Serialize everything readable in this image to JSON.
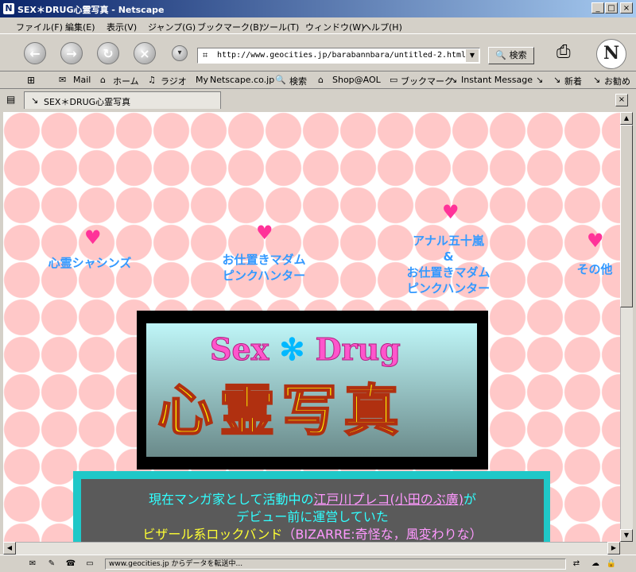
{
  "window": {
    "title": "SEX＊DRUG心霊写真 - Netscape",
    "app_icon": "netscape-icon",
    "minimize": "_",
    "maximize": "□",
    "close": "×"
  },
  "menu": [
    "ファイル(F)",
    "編集(E)",
    "表示(V)",
    "ジャンプ(G)",
    "ブックマーク(B)",
    "ツール(T)",
    "ウィンドウ(W)",
    "ヘルプ(H)"
  ],
  "nav": {
    "back_glyph": "←",
    "forward_glyph": "→",
    "reload_glyph": "↻",
    "stop_glyph": "×",
    "url": "http://www.geocities.jp/barabannbara/untitled-2.html",
    "search_label": "検索",
    "logo": "N"
  },
  "personal_toolbar": [
    "Mail",
    "ホーム",
    "ラジオ",
    "Netscape.co.jp",
    "検索",
    "Shop@AOL",
    "ブックマーク",
    "Instant Message",
    "",
    "新着",
    "お勧め"
  ],
  "tab": {
    "title": "SEX＊DRUG心霊写真",
    "close": "×"
  },
  "page": {
    "heart": "♥",
    "nav_links": [
      {
        "lines": [
          "心霊シャシンズ"
        ]
      },
      {
        "lines": [
          "お仕置きマダム",
          "ピンクハンター"
        ]
      },
      {
        "lines": [
          "アナル五十嵐",
          "&",
          "お仕置きマダム",
          "ピンクハンター"
        ]
      },
      {
        "lines": [
          "その他"
        ]
      }
    ],
    "banner": {
      "sex": "Sex",
      "star": "✻",
      "drug": "Drug",
      "main": "心霊写真"
    },
    "intro": {
      "line1_a": "現在マンガ家として活動中の",
      "line1_link": "江戸川プレコ(小田のぶ廣)",
      "line1_b": "が",
      "line2": "デビュー前に運営していた",
      "line3_a": "ビザール系",
      "line3_b": "ロックバンド",
      "line3_c": "（BIZARRE:奇怪な，風変わりな）"
    },
    "colors": {
      "link": "#3399ff",
      "heart": "#ff3399",
      "dot": "#ffc8c8"
    }
  },
  "status": {
    "text": "www.geocities.jp からデータを転送中..."
  }
}
